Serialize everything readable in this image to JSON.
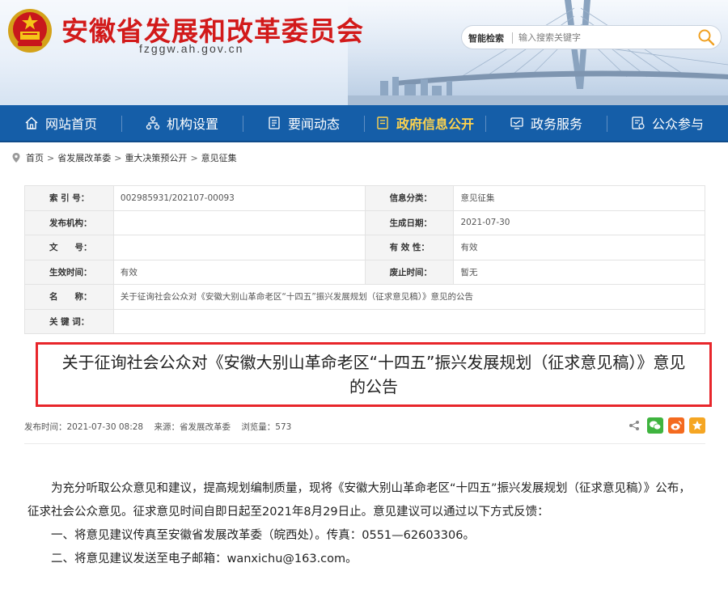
{
  "header": {
    "site_title": "安徽省发展和改革委员会",
    "site_domain": "fzggw.ah.gov.cn",
    "search_label": "智能检索",
    "search_placeholder": "输入搜索关键字"
  },
  "nav": {
    "items": [
      {
        "label": "网站首页",
        "icon": "home-icon"
      },
      {
        "label": "机构设置",
        "icon": "org-chart-icon"
      },
      {
        "label": "要闻动态",
        "icon": "news-icon"
      },
      {
        "label": "政府信息公开",
        "icon": "document-icon",
        "active": true
      },
      {
        "label": "政务服务",
        "icon": "service-icon"
      },
      {
        "label": "公众参与",
        "icon": "participation-icon"
      }
    ],
    "active_color": "#ffd34d",
    "bg_color": "#155ea8"
  },
  "breadcrumb": [
    "首页",
    "省发展改革委",
    "重大决策预公开",
    "意见征集"
  ],
  "info": {
    "index_no_label": "索 引 号：",
    "index_no": "002985931/202107-00093",
    "category_label": "信息分类：",
    "category": "意见征集",
    "publisher_label": "发布机构：",
    "publisher": "",
    "created_label": "生成日期：",
    "created": "2021-07-30",
    "doc_no_label": "文　　号：",
    "doc_no": "",
    "validity_label": "有 效 性：",
    "validity": "有效",
    "effective_label": "生效时间：",
    "effective": "有效",
    "abolish_label": "废止时间：",
    "abolish": "暂无",
    "name_label": "名　　称：",
    "name": "关于征询社会公众对《安徽大别山革命老区“十四五”振兴发展规划（征求意见稿）》意见的公告",
    "keywords_label": "关 键 词：",
    "keywords": ""
  },
  "article": {
    "title": "关于征询社会公众对《安徽大别山革命老区“十四五”振兴发展规划（征求意见稿）》意见的公告",
    "publish_time": "发布时间：2021-07-30 08:28",
    "source": "来源：省发展改革委",
    "views": "浏览量：573",
    "paragraphs": [
      "为充分听取公众意见和建议，提高规划编制质量，现将《安徽大别山革命老区“十四五”振兴发展规划（征求意见稿）》公布，征求社会公众意见。征求意见时间自即日起至2021年8月29日止。意见建议可以通过以下方式反馈：",
      "一、将意见建议传真至安徽省发展改革委（皖西处）。传真：0551—62603306。",
      "二、将意见建议发送至电子邮箱：wanxichu@163.com。"
    ]
  },
  "share": {
    "icons": [
      "share-icon",
      "wechat-icon",
      "weibo-icon",
      "favorite-icon"
    ]
  },
  "accent": {
    "title_red": "#d21a1a",
    "highlight_border": "#e8262b"
  }
}
